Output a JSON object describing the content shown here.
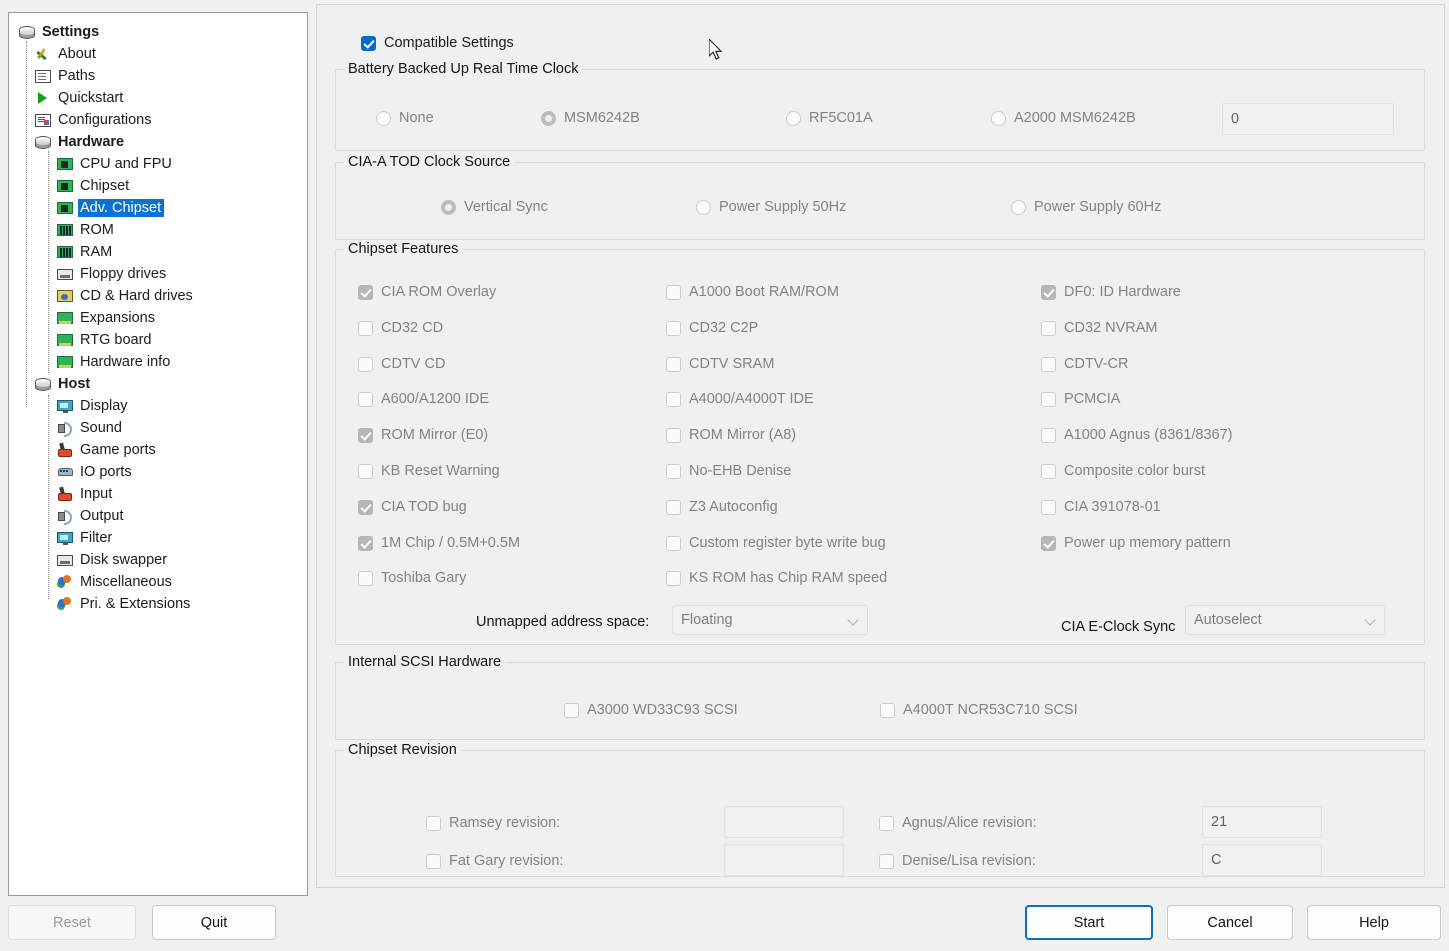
{
  "sidebar": {
    "title": "Settings",
    "items": [
      {
        "label": "Settings",
        "icon": "disk-icon",
        "level": "root",
        "bold": true,
        "selected": false
      },
      {
        "label": "About",
        "icon": "about-icon",
        "level": "lvl1",
        "bold": false,
        "selected": false
      },
      {
        "label": "Paths",
        "icon": "paths-icon",
        "level": "lvl1",
        "bold": false,
        "selected": false
      },
      {
        "label": "Quickstart",
        "icon": "play-icon",
        "level": "lvl1",
        "bold": false,
        "selected": false
      },
      {
        "label": "Configurations",
        "icon": "config-icon",
        "level": "lvl1",
        "bold": false,
        "selected": false
      },
      {
        "label": "Hardware",
        "icon": "disk-icon",
        "level": "lvl1",
        "bold": true,
        "selected": false
      },
      {
        "label": "CPU and FPU",
        "icon": "chip-icon",
        "level": "lvl2",
        "bold": false,
        "selected": false
      },
      {
        "label": "Chipset",
        "icon": "chip-icon",
        "level": "lvl2",
        "bold": false,
        "selected": false
      },
      {
        "label": "Adv. Chipset",
        "icon": "chip-icon",
        "level": "lvl2",
        "bold": false,
        "selected": true
      },
      {
        "label": "ROM",
        "icon": "ram-icon",
        "level": "lvl2",
        "bold": false,
        "selected": false
      },
      {
        "label": "RAM",
        "icon": "ram-icon",
        "level": "lvl2",
        "bold": false,
        "selected": false
      },
      {
        "label": "Floppy drives",
        "icon": "floppy-icon",
        "level": "lvl2",
        "bold": false,
        "selected": false
      },
      {
        "label": "CD & Hard drives",
        "icon": "cd-hd-icon",
        "level": "lvl2",
        "bold": false,
        "selected": false
      },
      {
        "label": "Expansions",
        "icon": "card-icon",
        "level": "lvl2",
        "bold": false,
        "selected": false
      },
      {
        "label": "RTG board",
        "icon": "card-icon",
        "level": "lvl2",
        "bold": false,
        "selected": false
      },
      {
        "label": "Hardware info",
        "icon": "card-icon",
        "level": "lvl2",
        "bold": false,
        "selected": false
      },
      {
        "label": "Host",
        "icon": "disk-icon",
        "level": "lvl1",
        "bold": true,
        "selected": false
      },
      {
        "label": "Display",
        "icon": "monitor-icon",
        "level": "lvl2",
        "bold": false,
        "selected": false
      },
      {
        "label": "Sound",
        "icon": "sound-icon",
        "level": "lvl2",
        "bold": false,
        "selected": false
      },
      {
        "label": "Game ports",
        "icon": "joystick-icon",
        "level": "lvl2",
        "bold": false,
        "selected": false
      },
      {
        "label": "IO ports",
        "icon": "io-ports-icon",
        "level": "lvl2",
        "bold": false,
        "selected": false
      },
      {
        "label": "Input",
        "icon": "joystick-icon",
        "level": "lvl2",
        "bold": false,
        "selected": false
      },
      {
        "label": "Output",
        "icon": "sound-icon",
        "level": "lvl2",
        "bold": false,
        "selected": false
      },
      {
        "label": "Filter",
        "icon": "monitor-icon",
        "level": "lvl2",
        "bold": false,
        "selected": false
      },
      {
        "label": "Disk swapper",
        "icon": "floppy-icon",
        "level": "lvl2",
        "bold": false,
        "selected": false
      },
      {
        "label": "Miscellaneous",
        "icon": "misc-icon",
        "level": "lvl2",
        "bold": false,
        "selected": false
      },
      {
        "label": "Pri. & Extensions",
        "icon": "misc-icon",
        "level": "lvl2",
        "bold": false,
        "selected": false
      }
    ]
  },
  "footer": {
    "reset_label": "Reset",
    "quit_label": "Quit",
    "start_label": "Start",
    "cancel_label": "Cancel",
    "help_label": "Help"
  },
  "main": {
    "compatible_settings": {
      "label": "Compatible Settings",
      "checked": true,
      "enabled": true
    },
    "rtc": {
      "caption": "Battery Backed Up Real Time Clock",
      "options": [
        {
          "label": "None",
          "selected": false
        },
        {
          "label": "MSM6242B",
          "selected": true
        },
        {
          "label": "RF5C01A",
          "selected": false
        },
        {
          "label": "A2000 MSM6242B",
          "selected": false
        }
      ],
      "offset_value": "0"
    },
    "tod": {
      "caption": "CIA-A TOD Clock Source",
      "options": [
        {
          "label": "Vertical Sync",
          "selected": true
        },
        {
          "label": "Power Supply 50Hz",
          "selected": false
        },
        {
          "label": "Power Supply 60Hz",
          "selected": false
        }
      ]
    },
    "chipset_features": {
      "caption": "Chipset Features",
      "col1": [
        {
          "label": "CIA ROM Overlay",
          "checked": true
        },
        {
          "label": "CD32 CD",
          "checked": false
        },
        {
          "label": "CDTV CD",
          "checked": false
        },
        {
          "label": "A600/A1200 IDE",
          "checked": false
        },
        {
          "label": "ROM Mirror (E0)",
          "checked": true
        },
        {
          "label": "KB Reset Warning",
          "checked": false
        },
        {
          "label": "CIA TOD bug",
          "checked": true
        },
        {
          "label": "1M Chip / 0.5M+0.5M",
          "checked": true
        },
        {
          "label": "Toshiba Gary",
          "checked": false
        }
      ],
      "col2": [
        {
          "label": "A1000 Boot RAM/ROM",
          "checked": false
        },
        {
          "label": "CD32 C2P",
          "checked": false
        },
        {
          "label": "CDTV SRAM",
          "checked": false
        },
        {
          "label": "A4000/A4000T IDE",
          "checked": false
        },
        {
          "label": "ROM Mirror (A8)",
          "checked": false
        },
        {
          "label": "No-EHB Denise",
          "checked": false
        },
        {
          "label": "Z3 Autoconfig",
          "checked": false
        },
        {
          "label": "Custom register byte write bug",
          "checked": false
        },
        {
          "label": "KS ROM has Chip RAM speed",
          "checked": false
        }
      ],
      "col3": [
        {
          "label": "DF0: ID Hardware",
          "checked": true
        },
        {
          "label": "CD32 NVRAM",
          "checked": false
        },
        {
          "label": "CDTV-CR",
          "checked": false
        },
        {
          "label": "PCMCIA",
          "checked": false
        },
        {
          "label": "A1000 Agnus (8361/8367)",
          "checked": false
        },
        {
          "label": "Composite color burst",
          "checked": false
        },
        {
          "label": "CIA 391078-01",
          "checked": false
        },
        {
          "label": "Power up memory pattern",
          "checked": true
        }
      ],
      "unmapped_label": "Unmapped address space:",
      "unmapped_value": "Floating",
      "eclock_label": "CIA E-Clock Sync",
      "eclock_value": "Autoselect"
    },
    "scsi": {
      "caption": "Internal SCSI Hardware",
      "options": [
        {
          "label": "A3000 WD33C93 SCSI",
          "checked": false
        },
        {
          "label": "A4000T NCR53C710 SCSI",
          "checked": false
        }
      ]
    },
    "revision": {
      "caption": "Chipset Revision",
      "rows": [
        {
          "label": "Ramsey revision:",
          "checked": false,
          "value": ""
        },
        {
          "label": "Fat Gary revision:",
          "checked": false,
          "value": ""
        }
      ],
      "rows2": [
        {
          "label": "Agnus/Alice revision:",
          "checked": false,
          "value": "21"
        },
        {
          "label": "Denise/Lisa revision:",
          "checked": false,
          "value": "C"
        }
      ]
    }
  },
  "colors": {
    "accent": "#0a6cc8",
    "selection": "#0a72d4",
    "window_bg": "#f0f0f0",
    "panel_bg": "#ffffff",
    "disabled_text": "#838383"
  }
}
